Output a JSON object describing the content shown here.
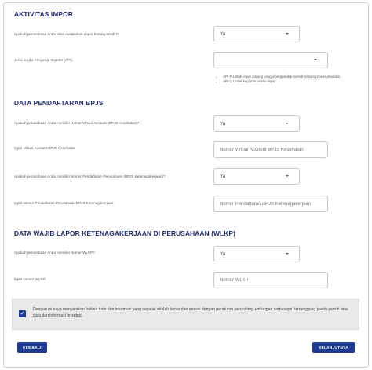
{
  "sections": {
    "impor": {
      "title": "AKTIVITAS IMPOR"
    },
    "bpjs": {
      "title": "DATA PENDAFTARAN BPJS"
    },
    "wlkp": {
      "title": "DATA WAJIB LAPOR KETENAGAKERJAAN DI PERUSAHAAN (WLKP)"
    }
  },
  "fields": {
    "impor_question": "Apakah perusahaan Anda akan melakukan impor barang sendiri?",
    "impor_value": "Ya",
    "importir_label": "Jenis angka Pengenal Importir (API):",
    "importir_value": "",
    "importir_notes": [
      "API-P Untuk impor barang yang dipergunakan sendiri dalam proses produksi",
      "API-U Untuk kegiatan usaha impor"
    ],
    "bpjs_kes_question": "Apakah perusahaan Anda memiliki Nomor Virtual Account (BPJS Kesehatan)?",
    "bpjs_kes_value": "Ya",
    "bpjs_kes_input_label": "Input Virtual Account BPJS Kesehatan",
    "bpjs_kes_placeholder": "Nomor Virtual Account BPJS Kesehatan",
    "bpjs_tk_question": "Apakah perusahaan Anda memiliki Nomor Pendaftaran Perusahaan (BPJS Ketenagakerjaan)?",
    "bpjs_tk_value": "Ya",
    "bpjs_tk_input_label": "Input Nomor Pendaftaran Perusahaan BPJS Ketenagakerjaan",
    "bpjs_tk_placeholder": "Nomor Pendaftaran BPJS Ketenagakerjaan",
    "wlkp_question": "Apakah perusahaan Anda memiliki Nomor WLKP?",
    "wlkp_value": "Ya",
    "wlkp_input_label": "Input Nomor WLKP:",
    "wlkp_placeholder": "Nomor WLKP"
  },
  "consent": {
    "checked": true,
    "text": "Dengan ini saya menyatakan bahwa data dan informasi yang saya isi adalah benar dan sesuai dengan peraturan perundang-undangan serta saya bertanggung jawab penuh atas data dan informasi tersebut."
  },
  "buttons": {
    "back": "KEMBALI",
    "next": "SELANJUTNYA"
  },
  "colors": {
    "primary": "#1f3a93",
    "heading": "#1f2a6b"
  }
}
